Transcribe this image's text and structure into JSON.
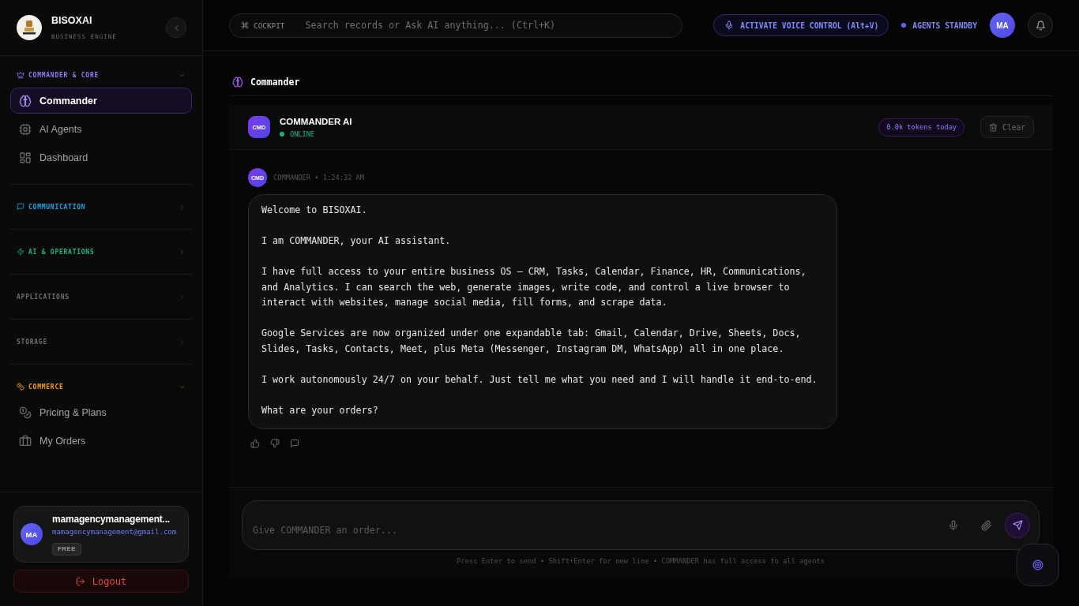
{
  "sidebar": {
    "brand": {
      "name": "BISOXAI",
      "tagline": "BUSINESS ENGINE"
    },
    "sections": [
      {
        "title": "COMMANDER & CORE",
        "color": "#8b7cf8",
        "expanded": true,
        "items": [
          {
            "label": "Commander",
            "selected": true
          },
          {
            "label": "AI Agents",
            "selected": false
          },
          {
            "label": "Dashboard",
            "selected": false
          }
        ]
      },
      {
        "title": "COMMUNICATION",
        "color": "#0ea5e9",
        "expanded": false
      },
      {
        "title": "AI & OPERATIONS",
        "color": "#10b981",
        "expanded": false
      },
      {
        "title": "APPLICATIONS",
        "color": "#6e6e6e",
        "expanded": false
      },
      {
        "title": "STORAGE",
        "color": "#6e6e6e",
        "expanded": false
      },
      {
        "title": "COMMERCE",
        "color": "#f59e0b",
        "expanded": true,
        "items": [
          {
            "label": "Pricing & Plans",
            "selected": false
          },
          {
            "label": "My Orders",
            "selected": false
          }
        ]
      }
    ],
    "user": {
      "initials": "MA",
      "name": "mamagencymanagement...",
      "email": "mamagencymanagement@gmail.com",
      "plan": "FREE"
    },
    "logout_button": "Logout"
  },
  "top_bar": {
    "search": {
      "tag": "COCKPIT",
      "placeholder": "Search records or Ask AI anything... (Ctrl+K)"
    },
    "voice_button": "ACTIVATE VOICE CONTROL (Alt+V)",
    "agents_status": "AGENTS STANDBY",
    "avatar": "MA"
  },
  "page": {
    "title": "Commander"
  },
  "chat": {
    "header": {
      "avatar": "CMD",
      "name": "COMMANDER AI",
      "status": "ONLINE",
      "online": true,
      "tokens": "0.0k tokens today",
      "clear_button": "Clear"
    },
    "messages": [
      {
        "avatar": "CMD",
        "meta": "COMMANDER • 1:24:32 AM",
        "paragraphs": [
          "Welcome to BISOXAI.",
          "I am COMMANDER, your AI assistant.",
          "I have full access to your entire business OS — CRM, Tasks, Calendar, Finance, HR, Communications, and Analytics. I can search the web, generate images, write code, and control a live browser to interact with websites, manage social media, fill forms, and scrape data.",
          "Google Services are now organized under one expandable tab: Gmail, Calendar, Drive, Sheets, Docs, Slides, Tasks, Contacts, Meet, plus Meta (Messenger, Instagram DM, WhatsApp) all in one place.",
          "I work autonomously 24/7 on your behalf. Just tell me what you need and I will handle it end-to-end.",
          "What are your orders?"
        ]
      }
    ],
    "composer": {
      "placeholder": "Give COMMANDER an order...",
      "hint": "Press Enter to send • Shift+Enter for new line • COMMANDER has full access to all agents"
    }
  }
}
